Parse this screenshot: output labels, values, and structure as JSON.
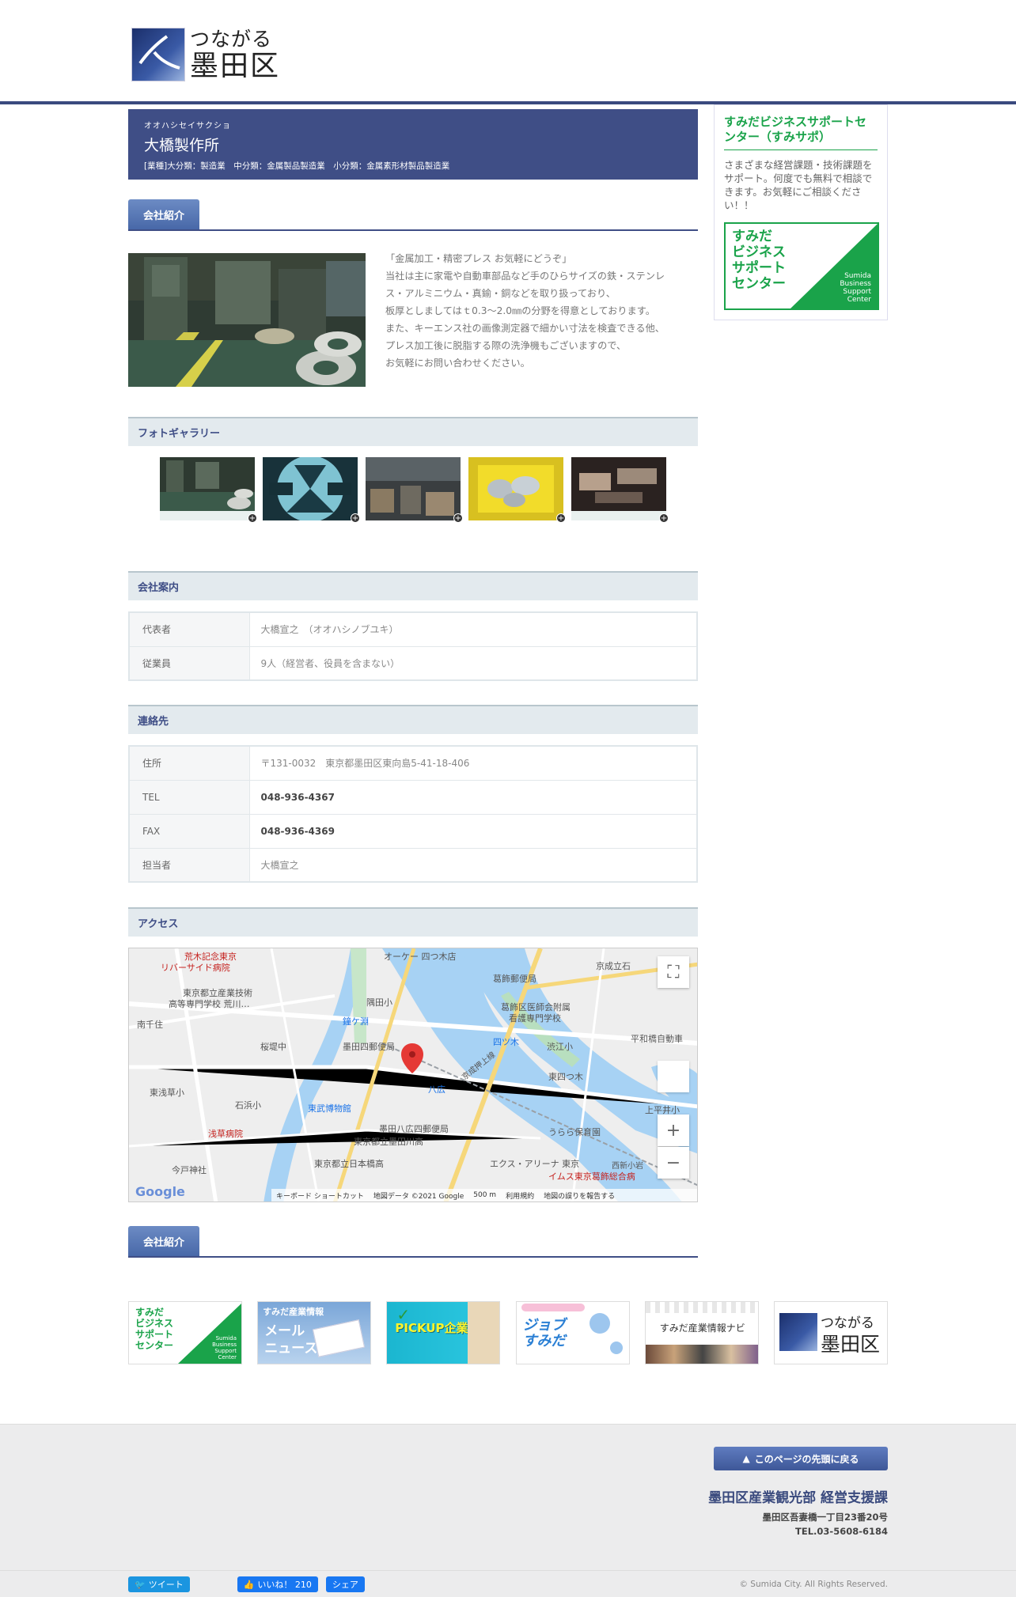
{
  "header": {
    "logo_line1": "つながる",
    "logo_line2": "墨田区"
  },
  "company": {
    "kana": "オオハシセイサクショ",
    "name": "大橋製作所",
    "categories": "[業種]大分類：製造業　中分類：金属製品製造業　小分類：金属素形材製品製造業"
  },
  "intro_heading": "会社紹介",
  "intro_lines": [
    "「金属加工・精密プレス お気軽にどうぞ」",
    "当社は主に家電や自動車部品など手のひらサイズの鉄・ステンレ",
    "ス・アルミニウム・真鍮・銅などを取り扱っており、",
    "板厚としましてはｔ0.3～2.0㎜の分野を得意としております。",
    "また、キーエンス社の画像測定器で細かい寸法を検査できる他、",
    "プレス加工後に脱脂する際の洗浄機もございますので、",
    "お気軽にお問い合わせください。"
  ],
  "gallery": {
    "title": "フォトギャラリー",
    "plus": "+"
  },
  "company_info": {
    "title": "会社案内",
    "rows": [
      {
        "k": "代表者",
        "v": "大橋宣之　（オオハシノブユキ）"
      },
      {
        "k": "従業員",
        "v": "9人（経営者、役員を含まない）"
      }
    ]
  },
  "contact": {
    "title": "連絡先",
    "rows": [
      {
        "k": "住所",
        "v": "〒131-0032　東京都墨田区東向島5-41-18-406"
      },
      {
        "k": "TEL",
        "v": "048-936-4367"
      },
      {
        "k": "FAX",
        "v": "048-936-4369"
      },
      {
        "k": "担当者",
        "v": "大橋宣之"
      }
    ]
  },
  "access": {
    "title": "アクセス",
    "map_labels": {
      "a": "荒木記念東京",
      "b": "リバーサイド病院",
      "c": "オーケー 四つ木店",
      "d": "葛飾郵便局",
      "e": "京成立石",
      "f": "東京都立産業技術",
      "g": "高等専門学校 荒川…",
      "h": "隅田小",
      "i": "南千住",
      "j": "葛飾区医師会附属",
      "k": "看護専門学校",
      "l": "鐘ケ淵",
      "m": "墨田四郵便局",
      "n": "四ツ木",
      "o": "渋江小",
      "p": "平和橋自動車",
      "q": "桜堤中",
      "r": "東四つ木",
      "s": "東浅草小",
      "t": "石浜小",
      "u": "東武博物館",
      "v": "八広",
      "w": "上平井小",
      "x": "浅草病院",
      "y": "墨田八広四郵便局",
      "z": "うらら保育園",
      "aa": "東京都立墨田川高",
      "ab": "今戸神社",
      "ac": "東京都立日本橋高",
      "ad": "エクス・アリーナ 東京",
      "ae": "イムス東京葛飾総合病",
      "af": "京成押上線",
      "ag": "西新小岩"
    },
    "google": "Google",
    "footer": [
      "キーボード ショートカット",
      "地図データ ©2021 Google",
      "500 m",
      "利用規約",
      "地図の誤りを報告する"
    ],
    "zoom_in": "+",
    "zoom_out": "−",
    "fullscreen": "⛶"
  },
  "company_intro2": "会社紹介",
  "sidebar": {
    "title": "すみだビジネスサポートセンター（すみサポ）",
    "desc": "さまざまな経営課題・技術課題をサポート。何度でも無料で相談できます。お気軽にご相談ください！！",
    "logo_jp": [
      "すみだ",
      "ビジネス",
      "サポート",
      "センター"
    ],
    "logo_en": [
      "Sumida",
      "Business",
      "Support",
      "Center"
    ]
  },
  "banners": [
    {
      "name": "sumisapo",
      "text": [
        "すみだ",
        "ビジネス",
        "サポート",
        "センター"
      ],
      "en": [
        "Sumida",
        "Business",
        "Support",
        "Center"
      ]
    },
    {
      "name": "mail-news",
      "text": [
        "すみだ産業情報",
        "メール",
        "ニュース"
      ]
    },
    {
      "name": "pickup",
      "text": [
        "PICKUP企業"
      ]
    },
    {
      "name": "job",
      "text": [
        "ジョブ",
        "すみだ"
      ]
    },
    {
      "name": "navi",
      "text": [
        "すみだ産業情報ナビ"
      ]
    },
    {
      "name": "tsunagaru",
      "text": [
        "つながる",
        "墨田区"
      ]
    }
  ],
  "footer": {
    "to_top": "このページの先頭に戻る",
    "dept": "墨田区産業観光部 経営支援課",
    "address": "墨田区吾妻橋一丁目23番20号",
    "tel": "TEL.03-5608-6184",
    "tweet": "ツイート",
    "like": "いいね！ 210",
    "share": "シェア",
    "copyright": "© Sumida City. All Rights Reserved."
  },
  "colors": {
    "navy": "#3f4e86",
    "green": "#1aa34a",
    "accent_blue": "#4868a8"
  }
}
